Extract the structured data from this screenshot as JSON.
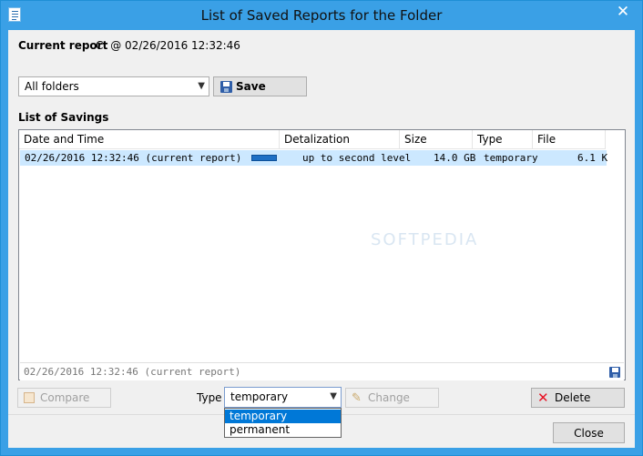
{
  "window": {
    "title": "List of Saved Reports for the Folder",
    "close_glyph": "✕"
  },
  "current_report": {
    "label": "Current report",
    "value": "C: @ 02/26/2016 12:32:46"
  },
  "folder_select": {
    "value": "All folders",
    "arrow": "▼"
  },
  "save_button": {
    "label": "Save",
    "icon": "save-icon"
  },
  "list": {
    "heading": "List of Savings",
    "columns": [
      "Date and Time",
      "Detalization",
      "Size",
      "Type",
      "File"
    ],
    "rows": [
      {
        "date": "02/26/2016 12:32:46 (current report)",
        "detalization": "up to second level",
        "size": "14.0 GB",
        "type": "temporary",
        "file": "6.1 K",
        "selected": true,
        "bar_fraction": 1.0
      }
    ],
    "status_text": "02/26/2016 12:32:46 (current report)"
  },
  "watermark": "SOFTPEDIA",
  "bottom": {
    "compare_label": "Compare",
    "type_label": "Type",
    "type_select": {
      "value": "temporary",
      "arrow": "▼",
      "options": [
        "temporary",
        "permanent"
      ]
    },
    "change_label": "Change",
    "delete_label": "Delete",
    "close_label": "Close"
  },
  "colors": {
    "titlebar": "#3aa0e6",
    "selection": "#cce8ff",
    "dropdown_highlight": "#0078d7",
    "delete_icon": "#e81123"
  }
}
